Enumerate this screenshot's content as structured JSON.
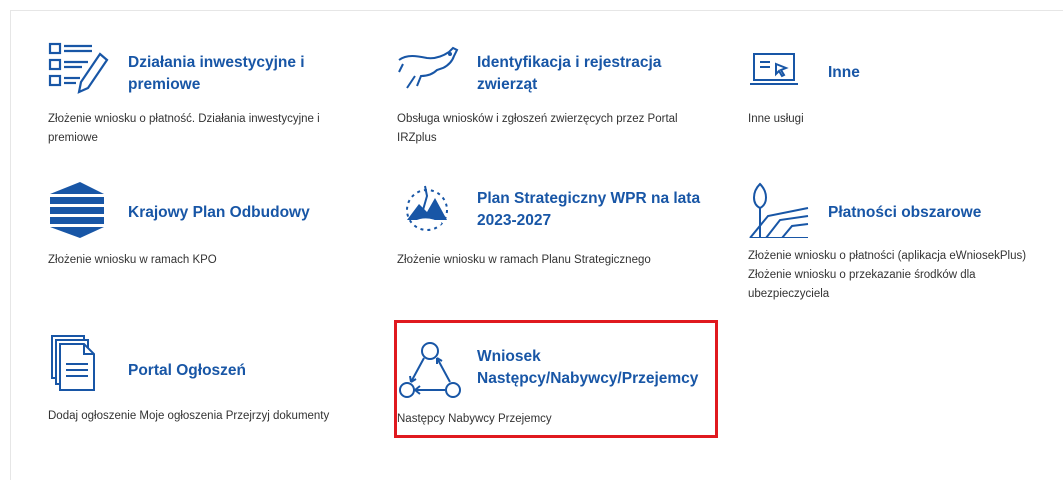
{
  "tiles": [
    {
      "title": "Działania inwestycyjne i\npremiowe",
      "description": "Złożenie wniosku o płatność. Działania inwestycyjne i\npremiowe",
      "icon": "document-list-pen-icon"
    },
    {
      "title": "Identyfikacja i rejestracja\nzwierząt",
      "description": "Obsługa wniosków i zgłoszeń zwierzęcych przez Portal\nIRZplus",
      "icon": "cow-icon"
    },
    {
      "title": "Inne",
      "description": "Inne usługi",
      "icon": "laptop-cursor-icon"
    },
    {
      "title": "Krajowy Plan Odbudowy",
      "description": "Złożenie wniosku w ramach KPO",
      "icon": "kpo-logo-icon"
    },
    {
      "title": "Plan Strategiczny WPR na lata\n2023-2027",
      "description": "Złożenie wniosku w ramach Planu Strategicznego",
      "icon": "wpr-logo-icon"
    },
    {
      "title": "Płatności obszarowe",
      "description": "Złożenie wniosku o płatności (aplikacja eWniosekPlus)\nZłożenie wniosku o przekazanie środków dla\nubezpieczyciela",
      "icon": "field-tree-icon"
    },
    {
      "title": "Portal Ogłoszeń",
      "description": "Dodaj ogłoszenie Moje ogłoszenia Przejrzyj dokumenty",
      "icon": "documents-stack-icon"
    },
    {
      "title": "Wniosek\nNastępcy/Nabywcy/Przejemcy",
      "description": "Następcy Nabywcy Przejemcy",
      "icon": "cycle-people-icon"
    }
  ],
  "colors": {
    "accent": "#1856a6",
    "highlight": "#e0191f",
    "text": "#333333"
  }
}
